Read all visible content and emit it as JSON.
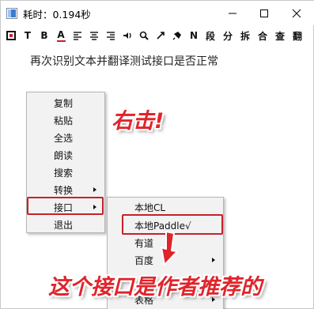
{
  "window": {
    "title": "耗时：0.194秒",
    "controls": {
      "minimize": "minimize",
      "maximize": "maximize",
      "close": "close"
    }
  },
  "toolbar": {
    "items": [
      {
        "name": "screenshot-icon",
        "label": ""
      },
      {
        "name": "text-icon",
        "label": "T"
      },
      {
        "name": "bold-icon",
        "label": "B"
      },
      {
        "name": "font-color-icon",
        "label": "A"
      },
      {
        "name": "align-left-icon",
        "label": ""
      },
      {
        "name": "align-center-icon",
        "label": ""
      },
      {
        "name": "align-right-icon",
        "label": ""
      },
      {
        "name": "speak-icon",
        "label": ""
      },
      {
        "name": "search-icon",
        "label": ""
      },
      {
        "name": "translate-icon",
        "label": ""
      },
      {
        "name": "pin-icon",
        "label": ""
      },
      {
        "name": "n-icon",
        "label": "N"
      },
      {
        "name": "paragraph-button",
        "label": "段"
      },
      {
        "name": "split-button",
        "label": "分"
      },
      {
        "name": "break-button",
        "label": "拆"
      },
      {
        "name": "merge-button",
        "label": "合"
      },
      {
        "name": "check-button",
        "label": "查"
      },
      {
        "name": "translate-button",
        "label": "翻"
      }
    ]
  },
  "content": {
    "text": "再次识别文本并翻译测试接口是否正常"
  },
  "context_menu": {
    "items": [
      {
        "label": "复制",
        "has_submenu": false
      },
      {
        "label": "粘贴",
        "has_submenu": false
      },
      {
        "label": "全选",
        "has_submenu": false
      },
      {
        "label": "朗读",
        "has_submenu": false
      },
      {
        "label": "搜索",
        "has_submenu": false
      },
      {
        "label": "转换",
        "has_submenu": true
      },
      {
        "label": "接口",
        "has_submenu": true
      },
      {
        "label": "退出",
        "has_submenu": false
      }
    ]
  },
  "submenu": {
    "items": [
      {
        "label": "本地CL",
        "has_submenu": false
      },
      {
        "label": "本地Paddle√",
        "has_submenu": false
      },
      {
        "label": "有道",
        "has_submenu": false
      },
      {
        "label": "百度",
        "has_submenu": true
      },
      {
        "label": "",
        "has_submenu": false
      },
      {
        "label": "表格",
        "has_submenu": true
      }
    ]
  },
  "annotations": {
    "right_click": "右击!",
    "recommended": "这个接口是作者推荐的"
  },
  "colors": {
    "highlight": "#c8202b",
    "annotation": "#e0242b",
    "menu_bg": "#f2f2f2"
  }
}
